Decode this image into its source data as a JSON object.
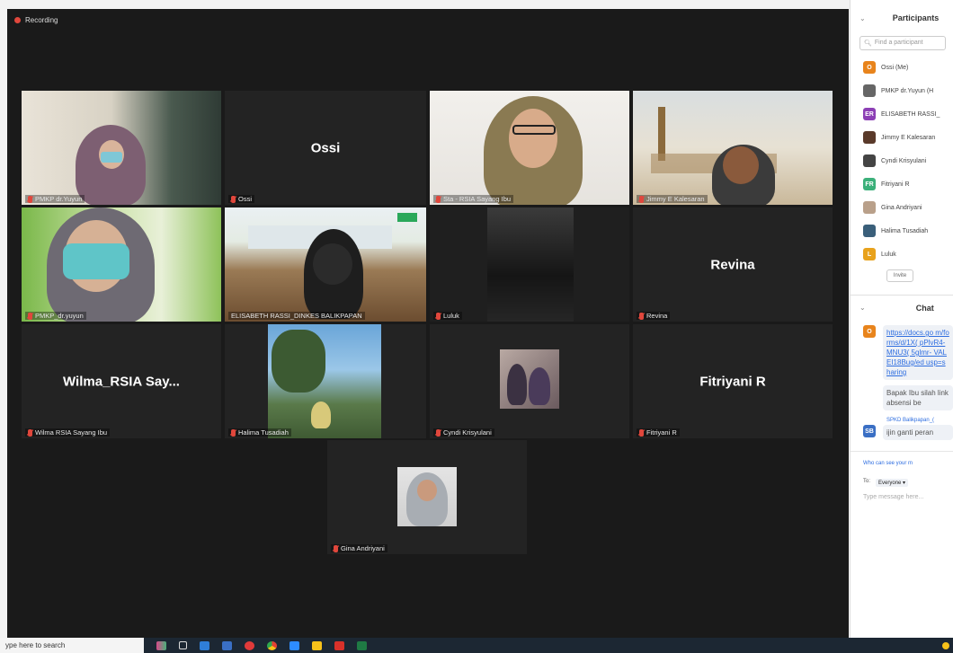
{
  "recording": {
    "label": "Recording"
  },
  "tiles": {
    "t1": {
      "label": "PMKP dr.Yuyun"
    },
    "t2": {
      "name": "Ossi",
      "label": "Ossi"
    },
    "t3": {
      "label": "Sta - RSIA Sayang Ibu"
    },
    "t4": {
      "label": "Jimmy E Kalesaran"
    },
    "t5": {
      "label": "PMKP_dr.yuyun"
    },
    "t6": {
      "label": "ELISABETH RASSI_DINKES BALIKPAPAN"
    },
    "t7": {
      "label": "Luluk"
    },
    "t8": {
      "name": "Revina",
      "label": "Revina"
    },
    "t9": {
      "name": "Wilma_RSIA  Say...",
      "label": "Wilma RSIA Sayang Ibu"
    },
    "t10": {
      "label": "Halima Tusadiah"
    },
    "t11": {
      "label": "Cyndi Krisyulani"
    },
    "t12": {
      "name": "Fitriyani R",
      "label": "Fitriyani R"
    },
    "t13": {
      "label": "Gina Andriyani"
    }
  },
  "participants": {
    "title": "Participants",
    "search_placeholder": "Find a participant",
    "items": [
      {
        "name": "Ossi (Me)",
        "initial": "O",
        "color": "#e8841c"
      },
      {
        "name": "PMKP dr.Yuyun (H",
        "initial": "",
        "color": "#666666"
      },
      {
        "name": "ELISABETH RASSI_",
        "initial": "ER",
        "color": "#8c3fb5"
      },
      {
        "name": "Jimmy E Kalesaran",
        "initial": "",
        "color": "#5a3a2a"
      },
      {
        "name": "Cyndi Krisyulani",
        "initial": "",
        "color": "#444444"
      },
      {
        "name": "Fitriyani R",
        "initial": "FR",
        "color": "#3bb07a"
      },
      {
        "name": "Gina Andriyani",
        "initial": "",
        "color": "#b9a08a"
      },
      {
        "name": "Halima Tusadiah",
        "initial": "",
        "color": "#3a5f7a"
      },
      {
        "name": "Luluk",
        "initial": "L",
        "color": "#e8a21c"
      }
    ],
    "invite_label": "Invite"
  },
  "chat": {
    "title": "Chat",
    "msg1_initial": "O",
    "msg1_link": "https://docs.go m/forms/d/1X( pPlvR4-MNU3( 5glmr- VALEI18Bug/ed usp=sharing",
    "msg2_text": "Bapak Ibu silah link absensi be",
    "sender2": "SPKD Balikpapan_(",
    "msg3_initial": "SB",
    "msg3_text": "ijin ganti peran",
    "who_can_see": "Who can see your m",
    "to_label": "To:",
    "to_value": "Everyone ▾",
    "input_placeholder": "Type message here..."
  },
  "taskbar": {
    "search_text": "ype here to search"
  }
}
